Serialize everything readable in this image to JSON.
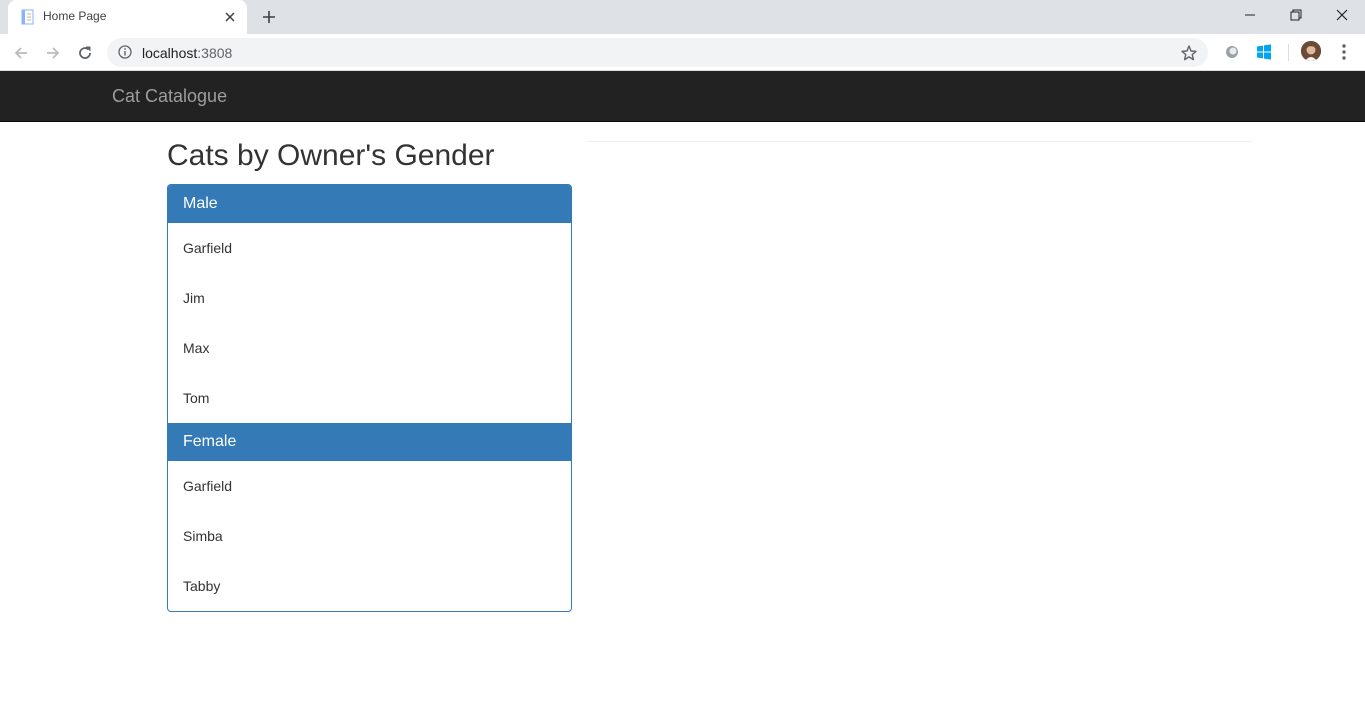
{
  "browser": {
    "tab_title": "Home Page",
    "url_host": "localhost",
    "url_port": ":3808",
    "icons": {
      "favicon": "page-icon",
      "tab_close": "close-icon",
      "new_tab": "plus-icon",
      "back": "back-arrow-icon",
      "forward": "forward-arrow-icon",
      "reload": "reload-icon",
      "site_info": "info-icon",
      "bookmark": "star-icon",
      "menu": "more-vert-icon"
    }
  },
  "navbar": {
    "brand": "Cat Catalogue"
  },
  "main": {
    "title": "Cats by Owner's Gender",
    "groups": [
      {
        "heading": "Male",
        "cats": [
          "Garfield",
          "Jim",
          "Max",
          "Tom"
        ]
      },
      {
        "heading": "Female",
        "cats": [
          "Garfield",
          "Simba",
          "Tabby"
        ]
      }
    ]
  },
  "colors": {
    "navbar_bg": "#222222",
    "brand_text": "#9d9d9d",
    "panel_primary": "#337ab7"
  }
}
